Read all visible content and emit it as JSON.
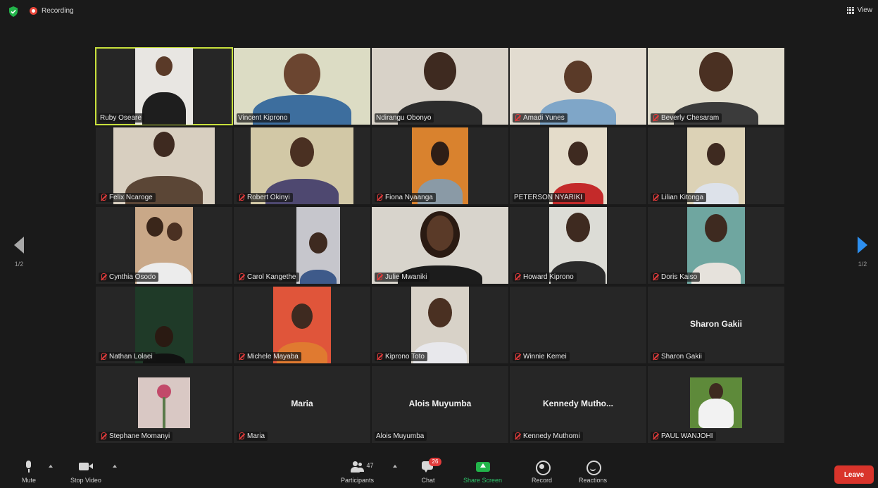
{
  "topbar": {
    "recording_label": "Recording",
    "view_label": "View",
    "security_icon": "shield-icon",
    "recording_icon": "recording-dot-icon",
    "view_icon": "grid-view-icon"
  },
  "gallery": {
    "page_indicator_left": "1/2",
    "page_indicator_right": "1/2",
    "active_speaker_color": "#c8e03c",
    "participants": [
      {
        "name": "Ruby Oseare",
        "muted": false,
        "video": true,
        "active": true
      },
      {
        "name": "Vincent Kiprono",
        "muted": false,
        "video": true
      },
      {
        "name": "Ndirangu Obonyo",
        "muted": false,
        "video": true
      },
      {
        "name": "Amadi Yunes",
        "muted": true,
        "video": true
      },
      {
        "name": "Beverly Chesaram",
        "muted": true,
        "video": true
      },
      {
        "name": "Felix Ncaroge",
        "muted": true,
        "video": true
      },
      {
        "name": "Robert Okinyi",
        "muted": true,
        "video": true
      },
      {
        "name": "Fiona Nyaanga",
        "muted": true,
        "video": true
      },
      {
        "name": "PETERSON NYARIKI",
        "muted": false,
        "video": true
      },
      {
        "name": "Lilian Kitonga",
        "muted": true,
        "video": true
      },
      {
        "name": "Cynthia Osodo",
        "muted": true,
        "video": true
      },
      {
        "name": "Carol Kangethe",
        "muted": true,
        "video": true
      },
      {
        "name": "Julie Mwaniki",
        "muted": true,
        "video": true
      },
      {
        "name": "Howard Kiprono",
        "muted": true,
        "video": true
      },
      {
        "name": "Doris Kaiso",
        "muted": true,
        "video": true
      },
      {
        "name": "Nathan Lolaei",
        "muted": true,
        "video": true
      },
      {
        "name": "Michele Mayaba",
        "muted": true,
        "video": true
      },
      {
        "name": "Kiprono Toto",
        "muted": true,
        "video": true
      },
      {
        "name": "Winnie Kemei",
        "muted": true,
        "video": false
      },
      {
        "name": "Sharon Gakii",
        "muted": true,
        "video": false,
        "display_name": "Sharon Gakii"
      },
      {
        "name": "Stephane Momanyi",
        "muted": true,
        "video": true
      },
      {
        "name": "Maria",
        "muted": true,
        "video": false,
        "display_name": "Maria"
      },
      {
        "name": "Alois Muyumba",
        "muted": false,
        "video": false,
        "display_name": "Alois Muyumba"
      },
      {
        "name": "Kennedy Muthomi",
        "muted": true,
        "video": false,
        "display_name": "Kennedy  Mutho..."
      },
      {
        "name": "PAUL WANJOHI",
        "muted": true,
        "video": true
      }
    ]
  },
  "toolbar": {
    "mute_label": "Mute",
    "stop_video_label": "Stop Video",
    "participants_label": "Participants",
    "participants_count": "47",
    "chat_label": "Chat",
    "chat_badge": "26",
    "share_screen_label": "Share Screen",
    "record_label": "Record",
    "reactions_label": "Reactions",
    "leave_label": "Leave",
    "share_color": "#22b44a",
    "leave_color": "#d9342b"
  }
}
